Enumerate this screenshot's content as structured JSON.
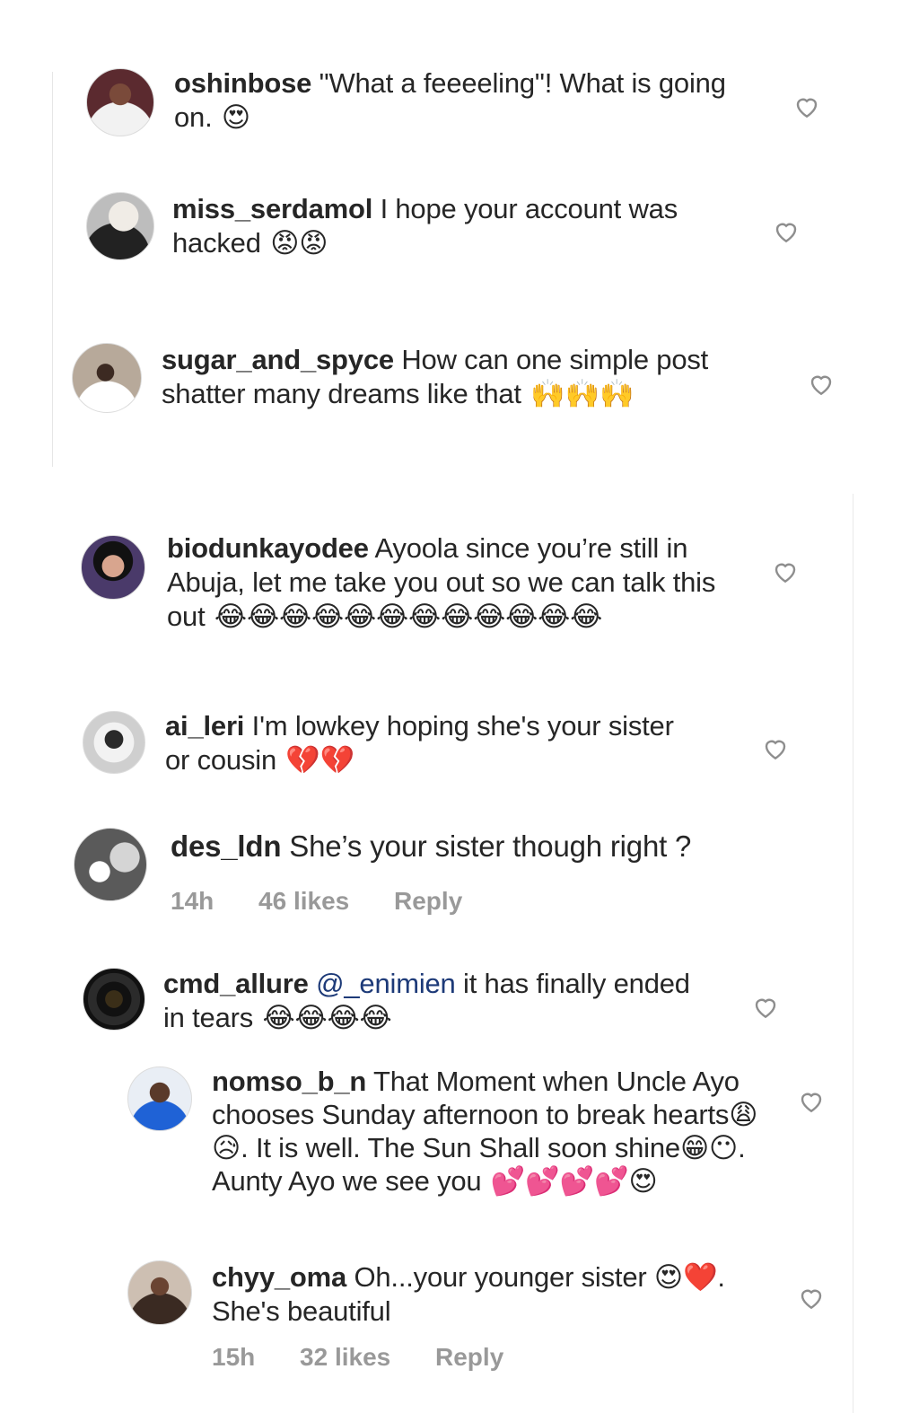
{
  "comments": [
    {
      "user": "oshinbose",
      "text": "\"What a feeeeling\"! What is going on.",
      "emoji": "😍"
    },
    {
      "user": "miss_serdamol",
      "text": "I hope your account was hacked",
      "emoji": "😡😡"
    },
    {
      "user": "sugar_and_spyce",
      "text": "How can one simple post shatter many dreams like that",
      "emoji": "🙌🙌🙌"
    },
    {
      "user": "biodunkayodee",
      "text": "Ayoola since you’re still in Abuja, let me take you out so we can talk this out",
      "emoji": "😂😂😂😂😂😂😂😂😂😂😂😂"
    },
    {
      "user": "ai_leri",
      "text": "I'm lowkey hoping she's your sister or cousin",
      "emoji": "💔💔"
    },
    {
      "user": "des_ldn",
      "text": "She’s your sister though right ?",
      "emoji": "",
      "time": "14h",
      "likes": "46 likes",
      "reply": "Reply"
    },
    {
      "user": "cmd_allure",
      "mention": "@_enimien",
      "text": "it has finally ended in tears",
      "emoji": "😂😂😂😂"
    },
    {
      "user": "nomso_b_n",
      "text": "That Moment when Uncle Ayo chooses Sunday afternoon to break hearts😩😥. It is well. The Sun Shall soon shine😁😶. Aunty Ayo we see you",
      "emoji": "💕💕💕💕😍"
    },
    {
      "user": "chyy_oma",
      "text": "Oh...your younger sister 😍❤️. She's beautiful",
      "emoji": "",
      "time": "15h",
      "likes": "32 likes",
      "reply": "Reply"
    }
  ],
  "icons": {
    "like": "heart-outline-icon"
  }
}
